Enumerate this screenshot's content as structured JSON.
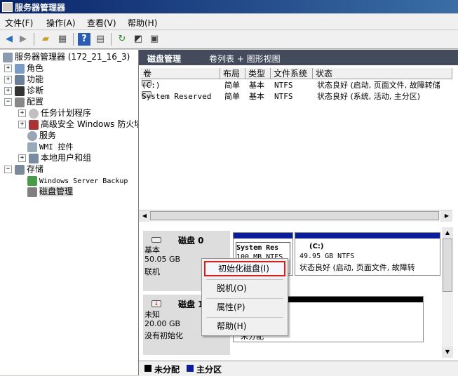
{
  "window": {
    "title": "服务器管理器"
  },
  "menu": [
    "文件(F)",
    "操作(A)",
    "查看(V)",
    "帮助(H)"
  ],
  "toolbar": [
    "back-icon",
    "forward-icon",
    "up-folder-icon",
    "show-hide-tree-icon",
    "help-icon",
    "properties-icon",
    "refresh-icon",
    "connect-icon",
    "export-icon"
  ],
  "tree": {
    "root": "服务器管理器 (172_21_16_3)",
    "roles": "角色",
    "features": "功能",
    "diagnostics": "诊断",
    "config": "配置",
    "task_scheduler": "任务计划程序",
    "firewall": "高级安全 Windows 防火墙",
    "services": "服务",
    "wmi": "WMI 控件",
    "local_users": "本地用户和组",
    "storage": "存储",
    "wsb": "Windows Server Backup",
    "disk_mgmt": "磁盘管理"
  },
  "header": {
    "title": "磁盘管理",
    "subtitle": "卷列表 + 图形视图"
  },
  "volume_columns": [
    "卷",
    "布局",
    "类型",
    "文件系统",
    "状态"
  ],
  "volumes": [
    {
      "name": "(C:)",
      "layout": "简单",
      "type": "基本",
      "fs": "NTFS",
      "status": "状态良好 (启动, 页面文件, 故障转储"
    },
    {
      "name": "System Reserved",
      "layout": "简单",
      "type": "基本",
      "fs": "NTFS",
      "status": "状态良好 (系统, 活动, 主分区)"
    }
  ],
  "disks": [
    {
      "name": "磁盘 0",
      "kind": "基本",
      "size": "50.05 GB",
      "state": "联机",
      "partitions": [
        {
          "name": "System Res",
          "line2": "100 MB NTFS"
        },
        {
          "name": "(C:)",
          "line2": "49.95 GB NTFS",
          "line3": "状态良好 (启动, 页面文件, 故障转"
        }
      ]
    },
    {
      "name": "磁盘 1",
      "kind": "未知",
      "size": "20.00 GB",
      "state": "没有初始化",
      "partitions": [
        {
          "name": "未分配"
        }
      ]
    }
  ],
  "context_menu": [
    "初始化磁盘(I)",
    "脱机(O)",
    "属性(P)",
    "帮助(H)"
  ],
  "legend": [
    {
      "label": "未分配",
      "color": "#000000"
    },
    {
      "label": "主分区",
      "color": "#0a1e9c"
    }
  ]
}
